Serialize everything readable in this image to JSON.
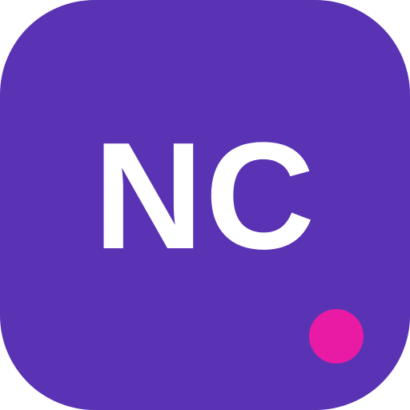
{
  "icon": {
    "monogram": "NC",
    "background_color": "#5933b3",
    "text_color": "#ffffff",
    "badge": {
      "name": "notification-dot",
      "color": "#e91ba5"
    }
  }
}
